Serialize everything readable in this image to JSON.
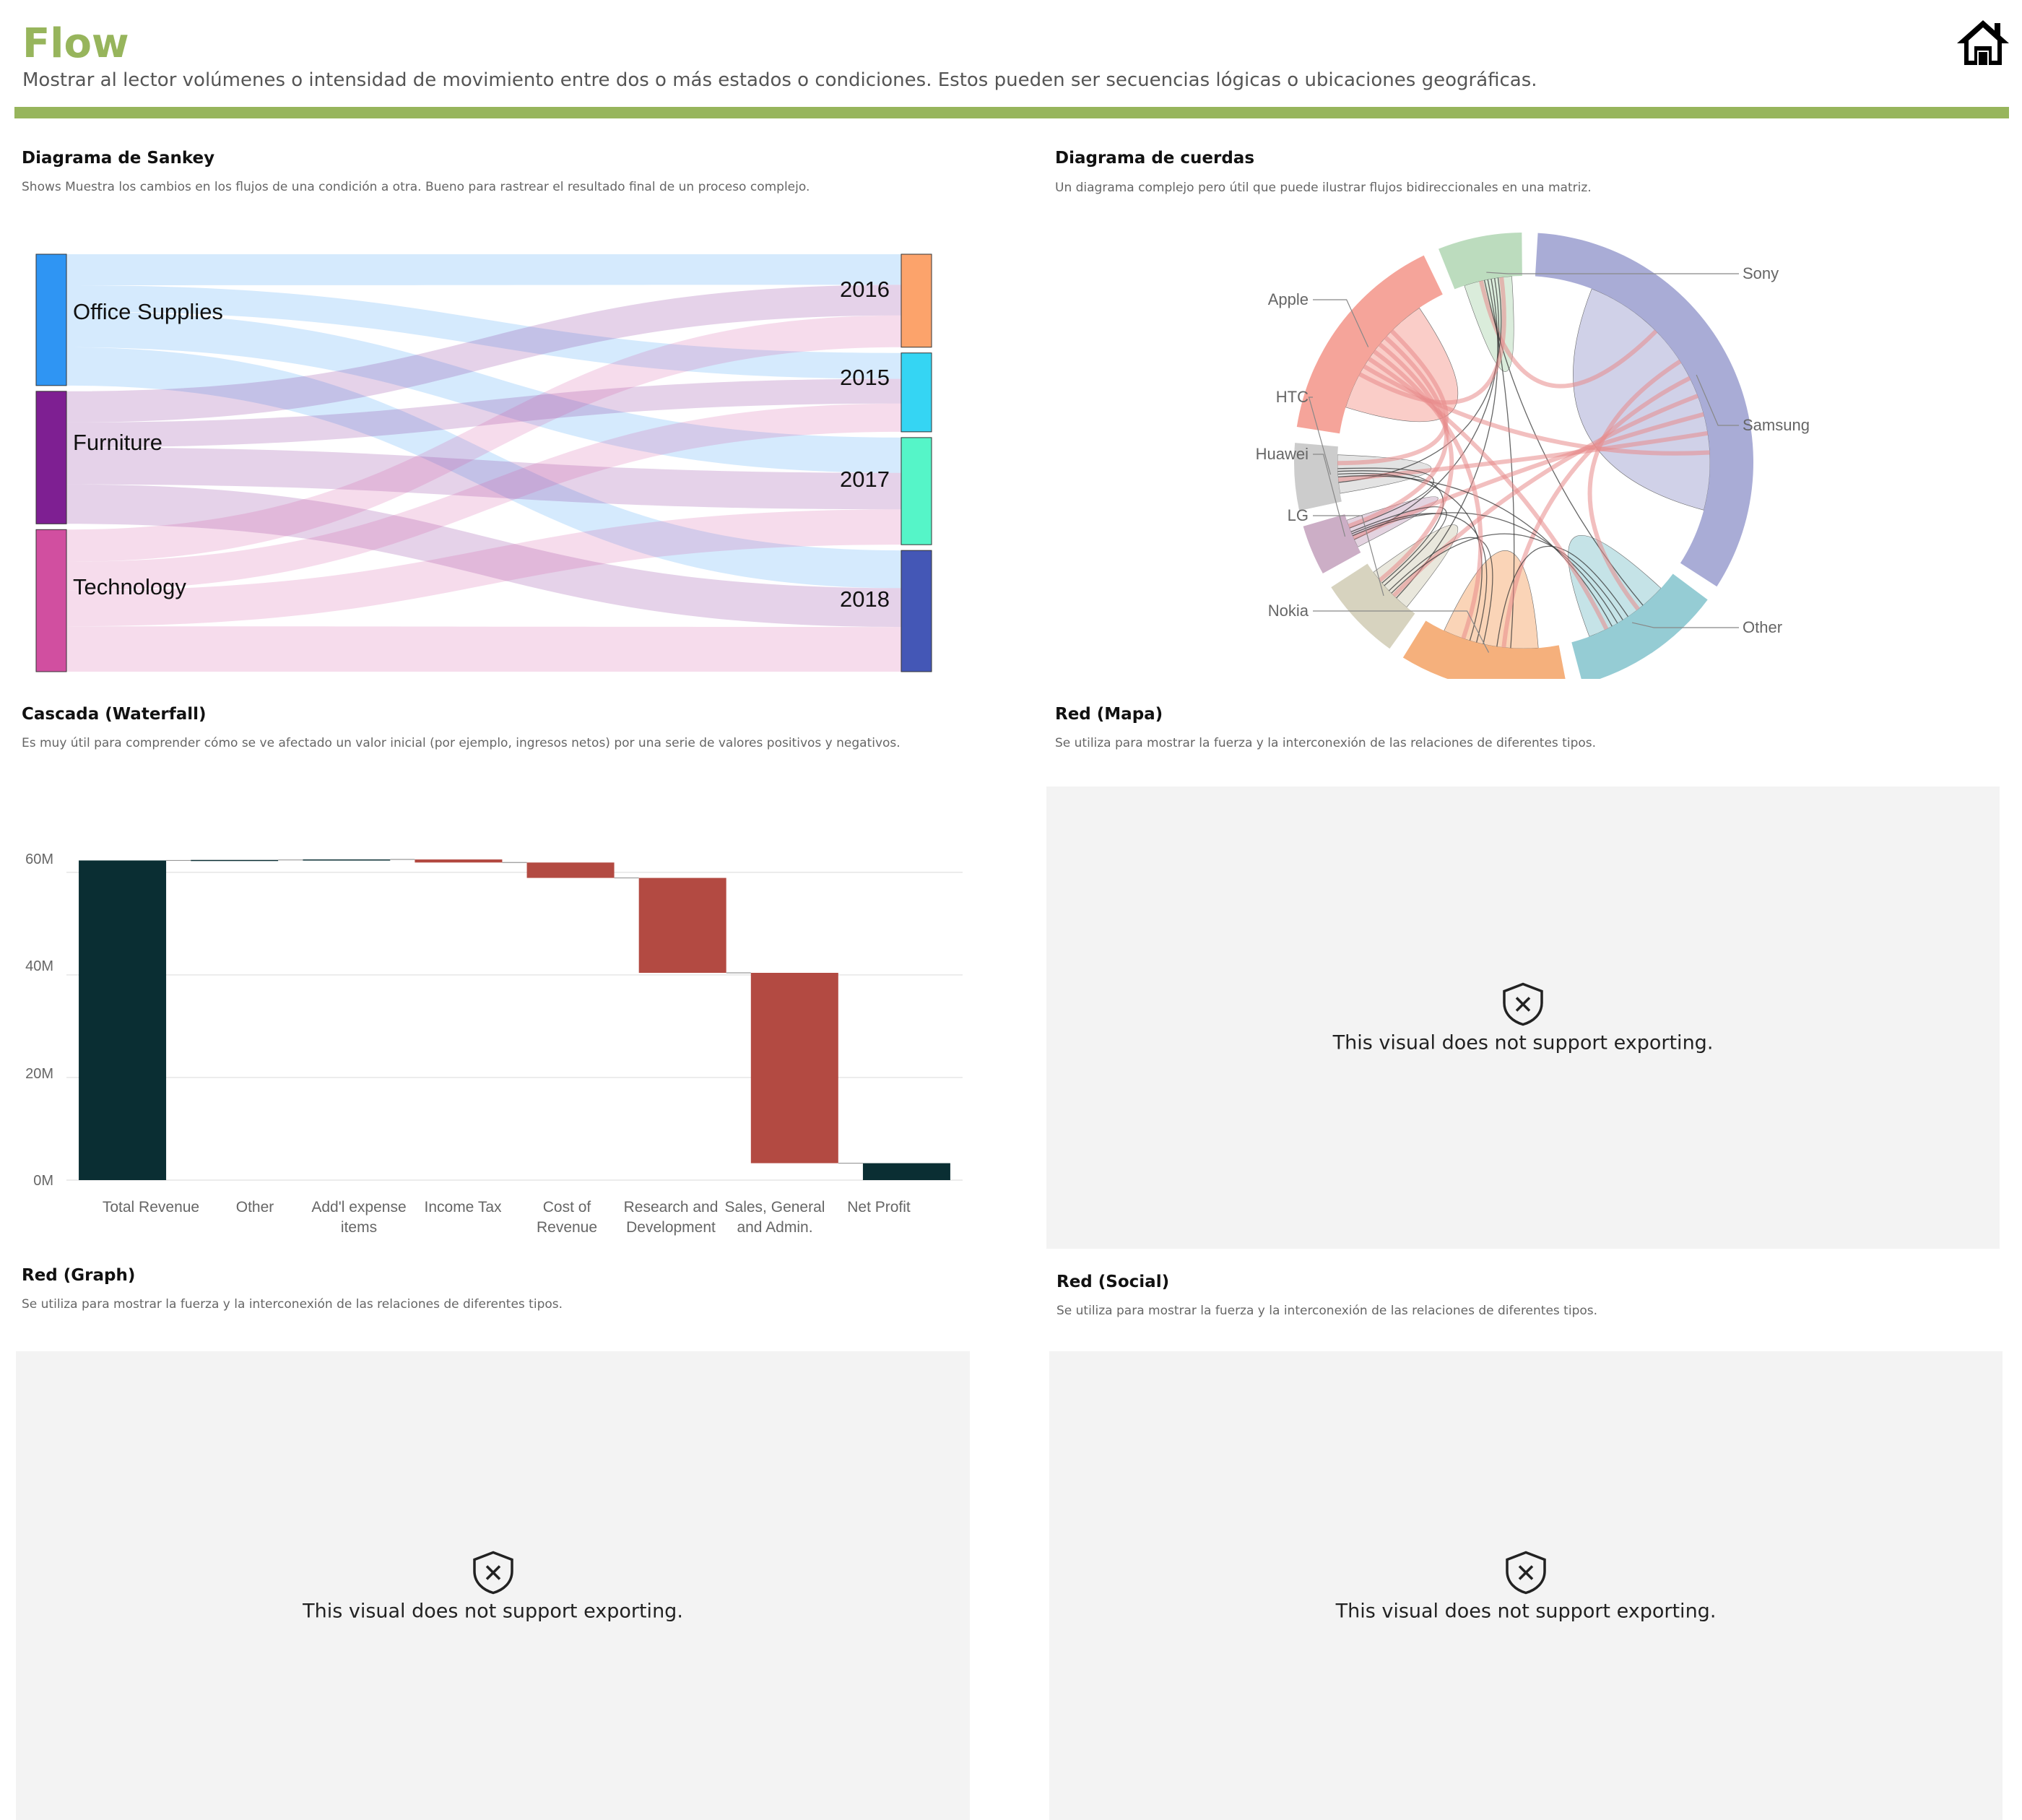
{
  "header": {
    "title": "Flow",
    "subtitle": "Mostrar al lector volúmenes o intensidad de movimiento entre dos o más estados o condiciones. Estos pueden ser secuencias lógicas o ubicaciones geográficas.",
    "home_icon": "home-icon",
    "accent_color": "#97b55c"
  },
  "visuals": {
    "sankey": {
      "title": "Diagrama de Sankey",
      "description": "Shows Muestra los cambios en los flujos de una condición a otra. Bueno para rastrear el resultado final de un proceso complejo.",
      "source_nodes": [
        {
          "label": "Office Supplies",
          "color": "#2f95f3"
        },
        {
          "label": "Furniture",
          "color": "#7e1f92"
        },
        {
          "label": "Technology",
          "color": "#d14fa0"
        }
      ],
      "target_nodes": [
        {
          "label": "2016",
          "color": "#fca36b"
        },
        {
          "label": "2015",
          "color": "#35d5f3"
        },
        {
          "label": "2017",
          "color": "#55f5c8"
        },
        {
          "label": "2018",
          "color": "#4457b6"
        }
      ]
    },
    "chord": {
      "title": "Diagrama de cuerdas",
      "description": "Un diagrama complejo pero útil que puede ilustrar flujos bidireccionales en una matriz.",
      "labels": [
        "Sony",
        "Samsung",
        "Other",
        "Nokia",
        "LG",
        "Huawei",
        "HTC",
        "Apple"
      ]
    },
    "waterfall": {
      "title": "Cascada (Waterfall)",
      "description": "Es muy útil para comprender cómo se ve afectado un valor inicial (por ejemplo, ingresos netos) por una serie de valores positivos y negativos.",
      "y_ticks": [
        "60M",
        "40M",
        "20M",
        "0M"
      ],
      "categories": [
        {
          "label1": "Total Revenue",
          "label2": ""
        },
        {
          "label1": "Other",
          "label2": ""
        },
        {
          "label1": "Add'l expense",
          "label2": "items"
        },
        {
          "label1": "Income Tax",
          "label2": ""
        },
        {
          "label1": "Cost of",
          "label2": "Revenue"
        },
        {
          "label1": "Research and",
          "label2": "Development"
        },
        {
          "label1": "Sales, General",
          "label2": "and Admin."
        },
        {
          "label1": "Net Profit",
          "label2": ""
        }
      ]
    },
    "red_mapa": {
      "title": "Red (Mapa)",
      "description": "Se utiliza para mostrar la fuerza y la interconexión de las relaciones de diferentes tipos.",
      "message": "This visual does not support exporting."
    },
    "red_graph": {
      "title": "Red (Graph)",
      "description": "Se utiliza para mostrar la fuerza y la interconexión de las relaciones de diferentes tipos.",
      "message": "This visual does not support exporting."
    },
    "red_social": {
      "title": "Red (Social)",
      "description": "Se utiliza para mostrar la fuerza y la interconexión de las relaciones de diferentes tipos.",
      "message": "This visual does not support exporting."
    }
  },
  "chart_data": [
    {
      "type": "sankey",
      "title": "Diagrama de Sankey",
      "sources": [
        "Office Supplies",
        "Furniture",
        "Technology"
      ],
      "targets": [
        "2016",
        "2015",
        "2017",
        "2018"
      ],
      "links": [
        {
          "source": "Office Supplies",
          "target": "2016",
          "value": 26
        },
        {
          "source": "Office Supplies",
          "target": "2015",
          "value": 22
        },
        {
          "source": "Office Supplies",
          "target": "2017",
          "value": 30
        },
        {
          "source": "Office Supplies",
          "target": "2018",
          "value": 32
        },
        {
          "source": "Furniture",
          "target": "2016",
          "value": 26
        },
        {
          "source": "Furniture",
          "target": "2015",
          "value": 21
        },
        {
          "source": "Furniture",
          "target": "2017",
          "value": 31
        },
        {
          "source": "Furniture",
          "target": "2018",
          "value": 33
        },
        {
          "source": "Technology",
          "target": "2016",
          "value": 27
        },
        {
          "source": "Technology",
          "target": "2015",
          "value": 24
        },
        {
          "source": "Technology",
          "target": "2017",
          "value": 30
        },
        {
          "source": "Technology",
          "target": "2018",
          "value": 38
        }
      ]
    },
    {
      "type": "chord",
      "title": "Diagrama de cuerdas",
      "groups": [
        {
          "name": "Sony",
          "color": "#bcdcbe",
          "value": 5
        },
        {
          "name": "Samsung",
          "color": "#a9acd6",
          "value": 28
        },
        {
          "name": "Other",
          "color": "#95ccd4",
          "value": 9
        },
        {
          "name": "Nokia",
          "color": "#f5b07c",
          "value": 10
        },
        {
          "name": "LG",
          "color": "#d7d3bf",
          "value": 5
        },
        {
          "name": "Huawei",
          "color": "#ccaec6",
          "value": 3
        },
        {
          "name": "HTC",
          "color": "#cccccc",
          "value": 4
        },
        {
          "name": "Apple",
          "color": "#f5a49a",
          "value": 13
        }
      ]
    },
    {
      "type": "waterfall",
      "title": "Cascada (Waterfall)",
      "categories": [
        "Total Revenue",
        "Other",
        "Add'l expense items",
        "Income Tax",
        "Cost of Revenue",
        "Research and Development",
        "Sales, General and Admin.",
        "Net Profit"
      ],
      "values": [
        62.3,
        0.1,
        0.1,
        -0.6,
        -3.0,
        -18.5,
        -37.1,
        3.3
      ],
      "value_unit": "M",
      "ylim": [
        0,
        65
      ],
      "positive_color": "#0a2e33",
      "negative_color": "#b34a42",
      "total_color": "#0a2e33",
      "grid": true
    }
  ]
}
